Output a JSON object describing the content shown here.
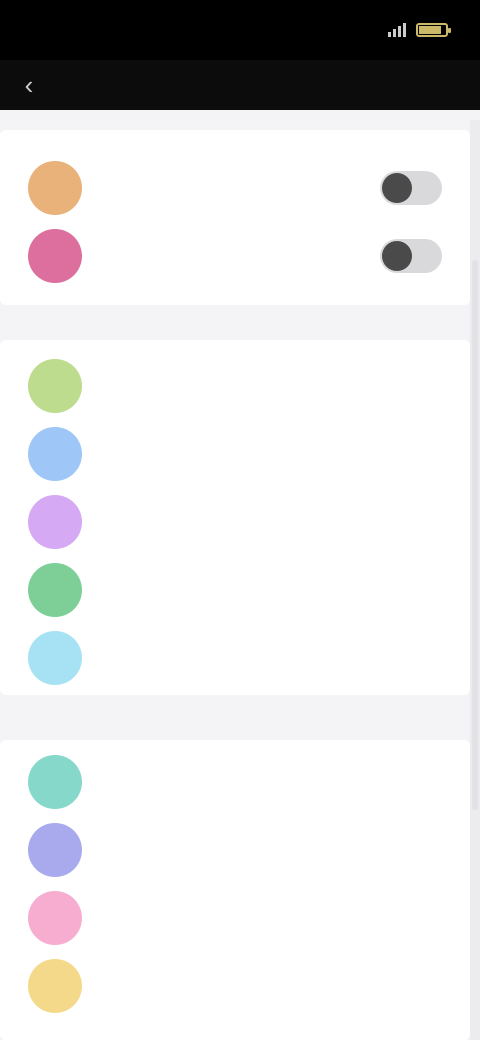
{
  "status_bar": {
    "time": "",
    "battery_level": 0.85,
    "battery_color": "#cbb968"
  },
  "nav": {
    "title": "",
    "back_icon": "back-arrow-icon"
  },
  "toggles": [
    {
      "label": "",
      "color": "#e8b27a",
      "on": false
    },
    {
      "label": "",
      "color": "#dc6f9e",
      "on": false
    }
  ],
  "section_1": {
    "header": "",
    "items": [
      {
        "label": "",
        "color": "#bedc8e"
      },
      {
        "label": "",
        "color": "#9ec6f6"
      },
      {
        "label": "",
        "color": "#d5a9f4"
      },
      {
        "label": "",
        "color": "#7dcf97"
      },
      {
        "label": "",
        "color": "#a6e2f3",
        "two_line": true
      }
    ]
  },
  "section_2": {
    "header": "",
    "items": [
      {
        "label": "",
        "color": "#86d8cb"
      },
      {
        "label": "",
        "color": "#a9aaee"
      },
      {
        "label": "",
        "color": "#f7add0"
      },
      {
        "label": "",
        "color": "#f5d98a"
      }
    ]
  }
}
